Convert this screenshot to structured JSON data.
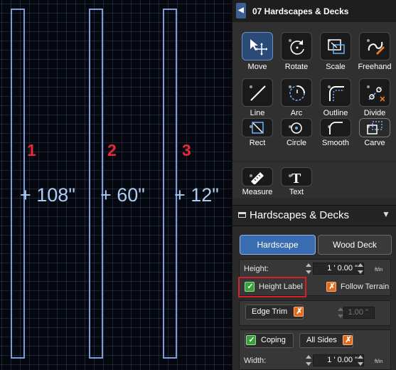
{
  "canvas": {
    "region_numbers": [
      "1",
      "2",
      "3"
    ],
    "height_labels": [
      "+ 108\"",
      "+ 60\"",
      "+ 12\""
    ]
  },
  "panel": {
    "title": "07 Hardscapes & Decks",
    "tools": [
      {
        "label": "Move",
        "icon": "move-icon"
      },
      {
        "label": "Rotate",
        "icon": "rotate-icon"
      },
      {
        "label": "Scale",
        "icon": "scale-icon"
      },
      {
        "label": "Freehand",
        "icon": "freehand-icon"
      },
      {
        "label": "Line",
        "icon": "line-icon"
      },
      {
        "label": "Arc",
        "icon": "arc-icon"
      },
      {
        "label": "Outline",
        "icon": "outline-icon"
      },
      {
        "label": "Divide",
        "icon": "divide-icon"
      },
      {
        "label": "Rect",
        "icon": "rect-icon"
      },
      {
        "label": "Circle",
        "icon": "circle-icon"
      },
      {
        "label": "Smooth",
        "icon": "smooth-icon"
      },
      {
        "label": "Carve",
        "icon": "carve-icon"
      }
    ],
    "tools2": [
      {
        "label": "Measure",
        "icon": "ruler-icon"
      },
      {
        "label": "Text",
        "icon": "text-icon"
      }
    ],
    "section_title": "Hardscapes & Decks",
    "type_tabs": {
      "hardscape": "Hardscape",
      "wood_deck": "Wood Deck"
    },
    "height": {
      "label": "Height:",
      "feet": "1",
      "feet_mark": "'",
      "inches": "0.00",
      "inch_mark": "\"",
      "unit": "ft/in"
    },
    "height_label_toggle": "Height Label",
    "follow_terrain_toggle": "Follow Terrain",
    "edge_trim": {
      "label": "Edge Trim",
      "value": "1.00",
      "inch_mark": "\""
    },
    "coping": "Coping",
    "all_sides": "All Sides",
    "width": {
      "label": "Width:",
      "feet": "1",
      "feet_mark": "'",
      "inches": "0.00",
      "inch_mark": "\"",
      "unit": "ft/in"
    }
  },
  "colors": {
    "accent": "#3c5e90",
    "annotation_red": "#d6202a",
    "region_number_red": "#e8283a",
    "height_label_blue": "#a9cdf5"
  }
}
